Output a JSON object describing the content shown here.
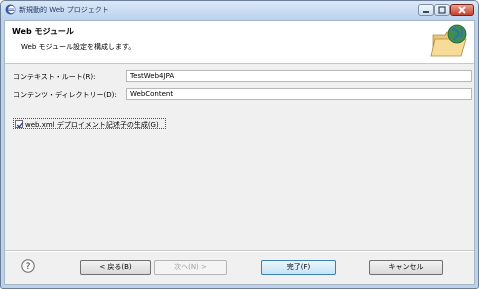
{
  "window": {
    "title": "新規動的 Web プロジェクト"
  },
  "header": {
    "title": "Web モジュール",
    "description": "Web モジュール設定を構成します。"
  },
  "form": {
    "context_root_label": "コンテキスト・ルート(R):",
    "context_root_value": "TestWeb4JPA",
    "content_dir_label": "コンテンツ・ディレクトリー(D):",
    "content_dir_value": "WebContent",
    "generate_webxml_label": "web.xml デプロイメント記述子の生成(G)",
    "generate_webxml_checked": true
  },
  "buttons": {
    "back": "< 戻る(B)",
    "next": "次へ(N) >",
    "finish": "完了(F)",
    "cancel": "キャンセル"
  },
  "icons": {
    "app": "eclipse-icon",
    "banner": "web-folder-globe-icon",
    "help": "help-icon"
  }
}
